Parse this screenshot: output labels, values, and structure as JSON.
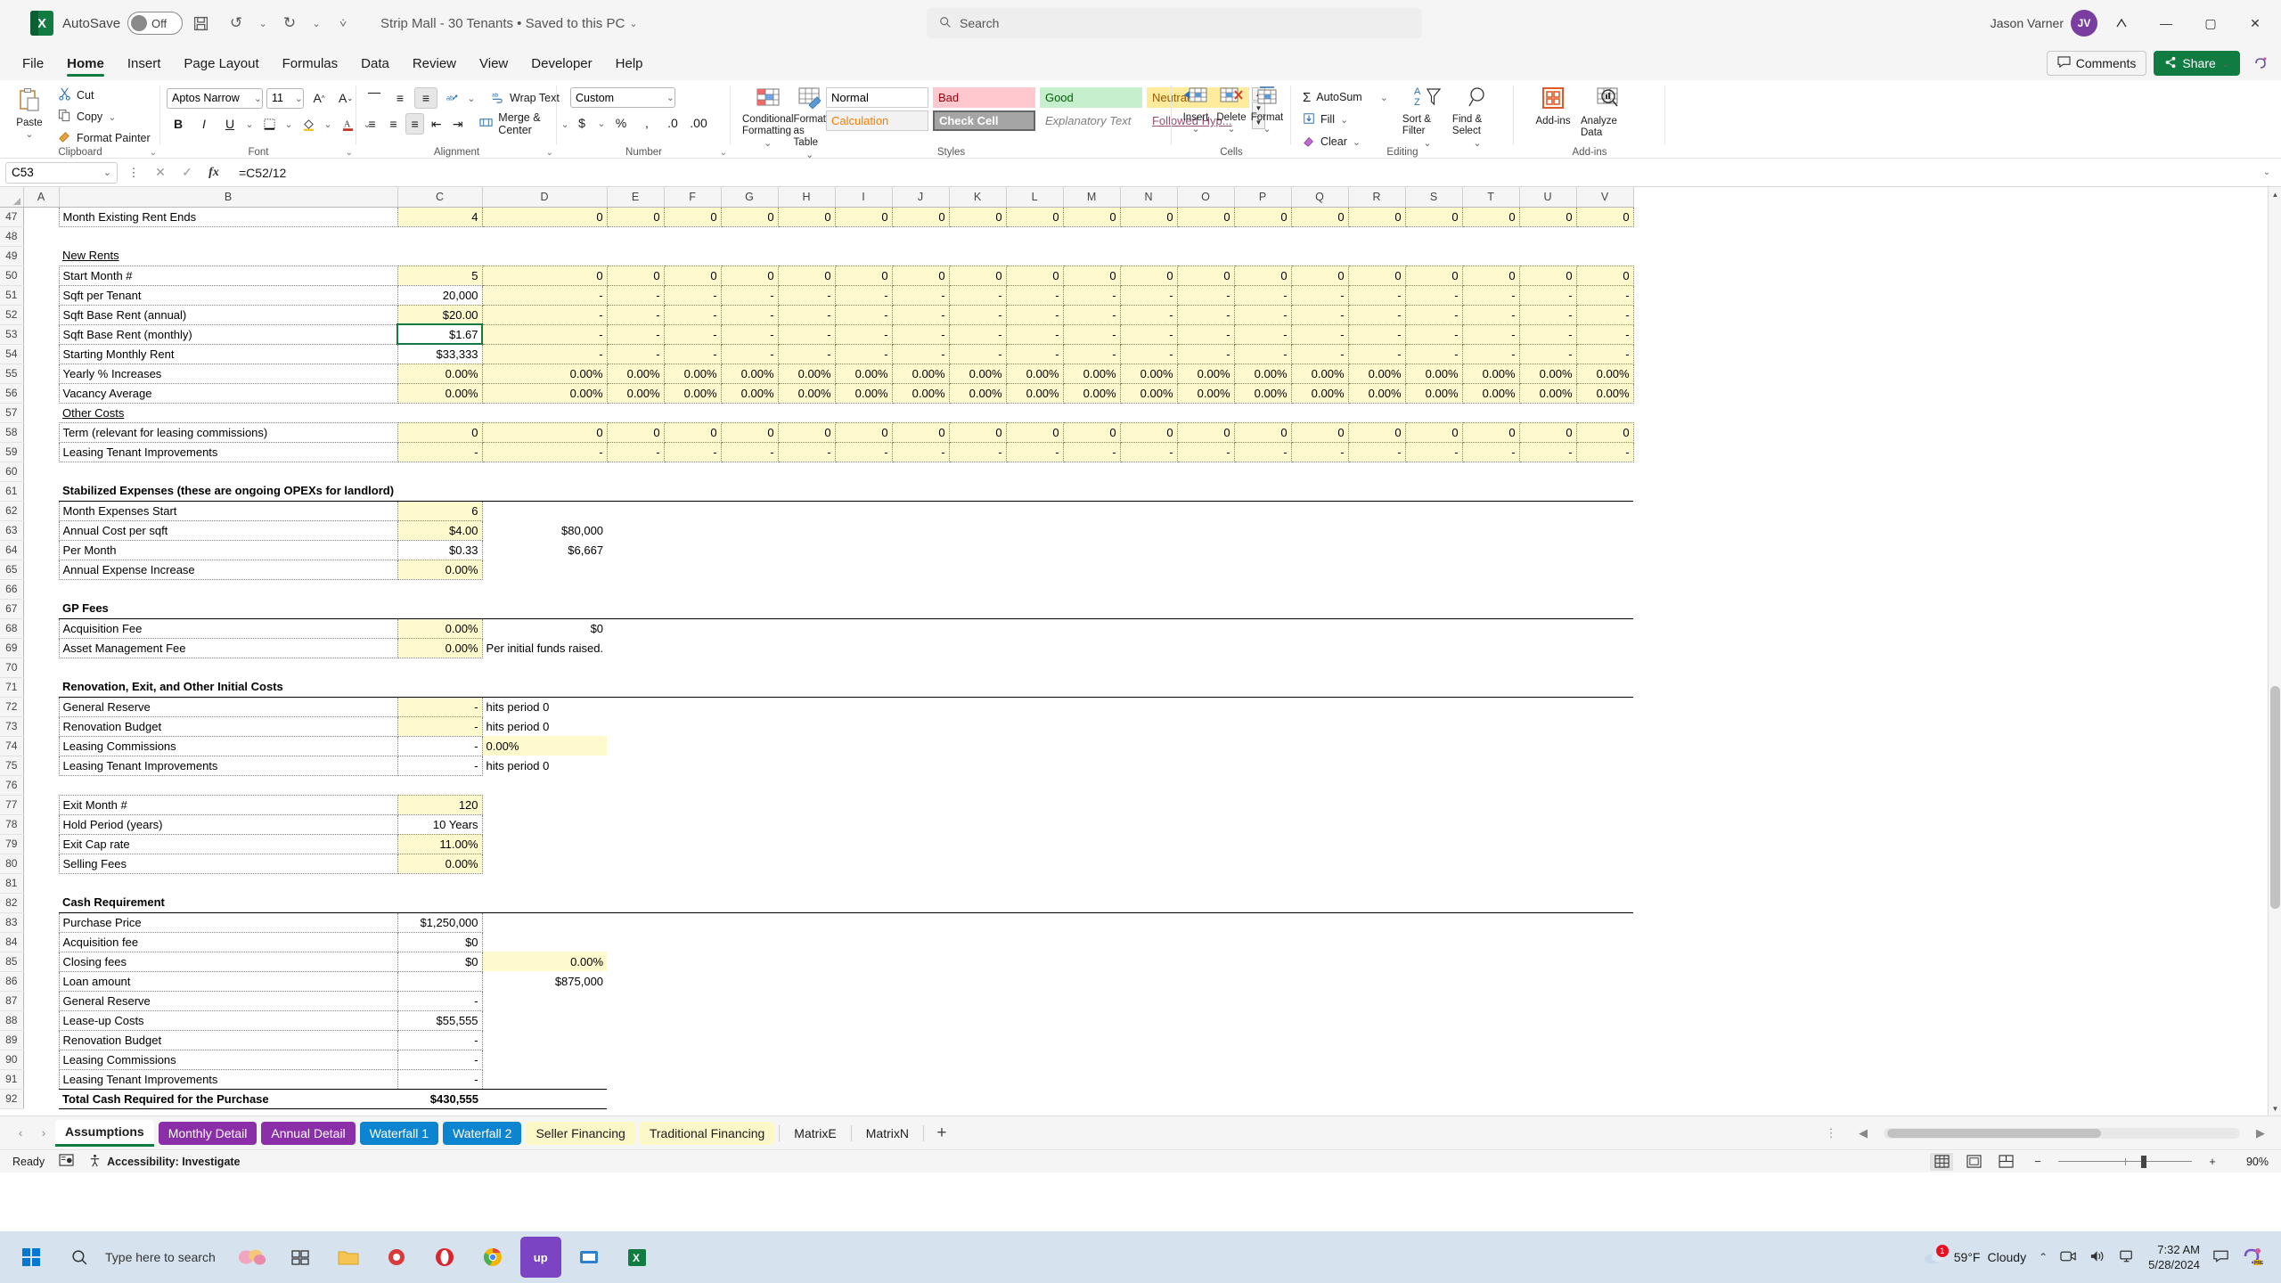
{
  "titlebar": {
    "autosave_label": "AutoSave",
    "autosave_state": "Off",
    "doc_title": "Strip Mall - 30 Tenants • Saved to this PC",
    "search_placeholder": "Search",
    "user_name": "Jason Varner",
    "user_initials": "JV",
    "icons": [
      "save-icon",
      "undo-icon",
      "redo-icon",
      "customize-quick-access-icon"
    ]
  },
  "menu": {
    "items": [
      "File",
      "Home",
      "Insert",
      "Page Layout",
      "Formulas",
      "Data",
      "Review",
      "View",
      "Developer",
      "Help"
    ],
    "active": "Home",
    "comments_label": "Comments",
    "share_label": "Share"
  },
  "ribbon": {
    "clipboard": {
      "label": "Clipboard",
      "paste": "Paste",
      "cut": "Cut",
      "copy": "Copy",
      "format_painter": "Format Painter"
    },
    "font": {
      "label": "Font",
      "family": "Aptos Narrow",
      "size": "11",
      "bold": "B",
      "italic": "I",
      "underline": "U"
    },
    "alignment": {
      "label": "Alignment",
      "wrap_text": "Wrap Text",
      "merge_center": "Merge & Center"
    },
    "number": {
      "label": "Number",
      "format": "Custom"
    },
    "styles": {
      "label": "Styles",
      "conditional_formatting": "Conditional Formatting",
      "format_as_table": "Format as Table",
      "gallery": [
        {
          "name": "Normal",
          "bg": "#ffffff",
          "fg": "#000000"
        },
        {
          "name": "Bad",
          "bg": "#ffc7ce",
          "fg": "#9c0006"
        },
        {
          "name": "Good",
          "bg": "#c6efce",
          "fg": "#006100"
        },
        {
          "name": "Neutral",
          "bg": "#ffeb9c",
          "fg": "#9c5700"
        },
        {
          "name": "Calculation",
          "bg": "#f2f2f2",
          "fg": "#fa7d00"
        },
        {
          "name": "Check Cell",
          "bg": "#a5a5a5",
          "fg": "#ffffff"
        },
        {
          "name": "Explanatory Text",
          "bg": "#ffffff",
          "fg": "#7f7f7f"
        },
        {
          "name": "Followed Hyp...",
          "bg": "#ffffff",
          "fg": "#954f72"
        }
      ]
    },
    "cells": {
      "label": "Cells",
      "insert": "Insert",
      "delete": "Delete",
      "format": "Format"
    },
    "editing": {
      "label": "Editing",
      "autosum": "AutoSum",
      "fill": "Fill",
      "clear": "Clear",
      "sort_filter": "Sort & Filter",
      "find_select": "Find & Select"
    },
    "addins": {
      "label": "Add-ins",
      "addins": "Add-ins",
      "analyze_data": "Analyze Data"
    }
  },
  "formula_bar": {
    "name_box": "C53",
    "formula": "=C52/12",
    "cancel_icon": "close-icon",
    "confirm_icon": "check-icon",
    "function_icon": "fx-icon"
  },
  "grid": {
    "columns": [
      "A",
      "B",
      "C",
      "D",
      "E",
      "F",
      "G",
      "H",
      "I",
      "J",
      "K",
      "L",
      "M",
      "N",
      "O",
      "P",
      "Q",
      "R",
      "S",
      "T",
      "U",
      "V"
    ],
    "active_cell": "C53",
    "rows": [
      {
        "n": 47,
        "label": "Month Existing Rent Ends",
        "indent": 1,
        "c": "4",
        "style": "yellow-blue",
        "series": [
          "0",
          "0",
          "0",
          "0",
          "0",
          "0",
          "0",
          "0",
          "0",
          "0",
          "0",
          "0",
          "0",
          "0",
          "0",
          "0",
          "0",
          "0",
          "0"
        ],
        "box": "mid"
      },
      {
        "n": 48,
        "label": "",
        "indent": 0,
        "c": "",
        "style": "blank",
        "series": []
      },
      {
        "n": 49,
        "label": "New Rents",
        "indent": 0,
        "c": "",
        "style": "section-underline",
        "series": []
      },
      {
        "n": 50,
        "label": "Start Month #",
        "indent": 1,
        "c": "5",
        "style": "yellow-blue",
        "series": [
          "0",
          "0",
          "0",
          "0",
          "0",
          "0",
          "0",
          "0",
          "0",
          "0",
          "0",
          "0",
          "0",
          "0",
          "0",
          "0",
          "0",
          "0",
          "0"
        ],
        "box": "top"
      },
      {
        "n": 51,
        "label": "Sqft per Tenant",
        "indent": 1,
        "c": "20,000",
        "style": "plain",
        "series": [
          "-",
          "-",
          "-",
          "-",
          "-",
          "-",
          "-",
          "-",
          "-",
          "-",
          "-",
          "-",
          "-",
          "-",
          "-",
          "-",
          "-",
          "-",
          "-"
        ],
        "box": "mid"
      },
      {
        "n": 52,
        "label": "Sqft Base Rent (annual)",
        "indent": 1,
        "c": "$20.00",
        "style": "yellow-blue",
        "series": [
          "-",
          "-",
          "-",
          "-",
          "-",
          "-",
          "-",
          "-",
          "-",
          "-",
          "-",
          "-",
          "-",
          "-",
          "-",
          "-",
          "-",
          "-",
          "-"
        ],
        "box": "mid"
      },
      {
        "n": 53,
        "label": "Sqft Base Rent (monthly)",
        "indent": 1,
        "c": "$1.67",
        "style": "plain",
        "series": [
          "-",
          "-",
          "-",
          "-",
          "-",
          "-",
          "-",
          "-",
          "-",
          "-",
          "-",
          "-",
          "-",
          "-",
          "-",
          "-",
          "-",
          "-",
          "-"
        ],
        "box": "mid"
      },
      {
        "n": 54,
        "label": "Starting Monthly Rent",
        "indent": 1,
        "c": "$33,333",
        "style": "plain",
        "series": [
          "-",
          "-",
          "-",
          "-",
          "-",
          "-",
          "-",
          "-",
          "-",
          "-",
          "-",
          "-",
          "-",
          "-",
          "-",
          "-",
          "-",
          "-",
          "-"
        ],
        "box": "mid"
      },
      {
        "n": 55,
        "label": "Yearly % Increases",
        "indent": 1,
        "c": "0.00%",
        "style": "yellow-blue",
        "series": [
          "0.00%",
          "0.00%",
          "0.00%",
          "0.00%",
          "0.00%",
          "0.00%",
          "0.00%",
          "0.00%",
          "0.00%",
          "0.00%",
          "0.00%",
          "0.00%",
          "0.00%",
          "0.00%",
          "0.00%",
          "0.00%",
          "0.00%",
          "0.00%",
          "0.00%"
        ],
        "box": "mid"
      },
      {
        "n": 56,
        "label": "Vacancy Average",
        "indent": 1,
        "c": "0.00%",
        "style": "yellow-blue",
        "series": [
          "0.00%",
          "0.00%",
          "0.00%",
          "0.00%",
          "0.00%",
          "0.00%",
          "0.00%",
          "0.00%",
          "0.00%",
          "0.00%",
          "0.00%",
          "0.00%",
          "0.00%",
          "0.00%",
          "0.00%",
          "0.00%",
          "0.00%",
          "0.00%",
          "0.00%"
        ],
        "box": "bot"
      },
      {
        "n": 57,
        "label": "Other Costs",
        "indent": 0,
        "c": "",
        "style": "section-underline",
        "series": []
      },
      {
        "n": 58,
        "label": "Term (relevant for leasing commissions)",
        "indent": 1,
        "c": "0",
        "style": "yellow-blue",
        "series": [
          "0",
          "0",
          "0",
          "0",
          "0",
          "0",
          "0",
          "0",
          "0",
          "0",
          "0",
          "0",
          "0",
          "0",
          "0",
          "0",
          "0",
          "0",
          "0"
        ],
        "box": "top"
      },
      {
        "n": 59,
        "label": "Leasing Tenant Improvements",
        "indent": 1,
        "c": "-",
        "style": "yellow-blue",
        "series": [
          "-",
          "-",
          "-",
          "-",
          "-",
          "-",
          "-",
          "-",
          "-",
          "-",
          "-",
          "-",
          "-",
          "-",
          "-",
          "-",
          "-",
          "-",
          "-"
        ],
        "box": "bot"
      },
      {
        "n": 60,
        "label": "",
        "indent": 0,
        "c": "",
        "style": "blank",
        "series": []
      },
      {
        "n": 61,
        "label": "Stabilized Expenses (these are ongoing OPEXs for landlord)",
        "indent": 0,
        "c": "",
        "style": "header-bold",
        "series": []
      },
      {
        "n": 62,
        "label": "Month Expenses Start",
        "indent": 1,
        "c": "6",
        "style": "yellow-blue",
        "series": [],
        "d": ""
      },
      {
        "n": 63,
        "label": "Annual Cost per sqft",
        "indent": 1,
        "c": "$4.00",
        "style": "yellow-blue",
        "series": [],
        "d": "$80,000"
      },
      {
        "n": 64,
        "label": "Per Month",
        "indent": 2,
        "c": "$0.33",
        "style": "plain",
        "series": [],
        "d": "$6,667"
      },
      {
        "n": 65,
        "label": "Annual Expense Increase",
        "indent": 1,
        "c": "0.00%",
        "style": "yellow-blue-end",
        "series": [],
        "d": ""
      },
      {
        "n": 66,
        "label": "",
        "indent": 0,
        "c": "",
        "style": "blank",
        "series": []
      },
      {
        "n": 67,
        "label": "GP Fees",
        "indent": 0,
        "c": "",
        "style": "header-bold",
        "series": []
      },
      {
        "n": 68,
        "label": "Acquisition Fee",
        "indent": 1,
        "c": "0.00%",
        "style": "yellow-blue",
        "series": [],
        "d": "$0"
      },
      {
        "n": 69,
        "label": "Asset Management Fee",
        "indent": 1,
        "c": "0.00%",
        "style": "yellow-blue",
        "series": [],
        "d": "Per initial funds raised.",
        "d_align": "left"
      },
      {
        "n": 70,
        "label": "",
        "indent": 0,
        "c": "",
        "style": "blank",
        "series": []
      },
      {
        "n": 71,
        "label": "Renovation, Exit, and Other Initial Costs",
        "indent": 0,
        "c": "",
        "style": "header-bold",
        "series": []
      },
      {
        "n": 72,
        "label": "General Reserve",
        "indent": 1,
        "c": "-",
        "style": "yellow-blue",
        "series": [],
        "d": "hits period 0",
        "d_align": "left",
        "box": "top"
      },
      {
        "n": 73,
        "label": "Renovation Budget",
        "indent": 1,
        "c": "-",
        "style": "yellow-blue",
        "series": [],
        "d": "hits period 0",
        "d_align": "left",
        "box": "mid"
      },
      {
        "n": 74,
        "label": "Leasing Commissions",
        "indent": 1,
        "c": "-",
        "style": "plain",
        "series": [],
        "d": "0.00%",
        "d_align": "left",
        "d_style": "yellow-blue",
        "box": "mid"
      },
      {
        "n": 75,
        "label": "Leasing Tenant Improvements",
        "indent": 1,
        "c": "-",
        "style": "plain",
        "series": [],
        "d": "hits period 0",
        "d_align": "left",
        "box": "bot"
      },
      {
        "n": 76,
        "label": "",
        "indent": 0,
        "c": "",
        "style": "blank",
        "series": []
      },
      {
        "n": 77,
        "label": "Exit Month #",
        "indent": 1,
        "c": "120",
        "style": "yellow-blue",
        "series": [],
        "box": "top"
      },
      {
        "n": 78,
        "label": "Hold Period (years)",
        "indent": 1,
        "c": "10 Years",
        "style": "plain",
        "series": [],
        "box": "mid"
      },
      {
        "n": 79,
        "label": "Exit Cap rate",
        "indent": 1,
        "c": "11.00%",
        "style": "yellow-blue",
        "series": [],
        "box": "mid"
      },
      {
        "n": 80,
        "label": "Selling Fees",
        "indent": 1,
        "c": "0.00%",
        "style": "yellow-blue",
        "series": [],
        "box": "bot"
      },
      {
        "n": 81,
        "label": "",
        "indent": 0,
        "c": "",
        "style": "blank",
        "series": []
      },
      {
        "n": 82,
        "label": "Cash Requirement",
        "indent": 0,
        "c": "",
        "style": "header-bold",
        "series": []
      },
      {
        "n": 83,
        "label": "Purchase Price",
        "indent": 1,
        "c": "$1,250,000",
        "style": "plain",
        "series": []
      },
      {
        "n": 84,
        "label": "Acquisition fee",
        "indent": 1,
        "c": "$0",
        "style": "plain",
        "series": []
      },
      {
        "n": 85,
        "label": "Closing fees",
        "indent": 1,
        "c": "$0",
        "style": "plain",
        "series": [],
        "d": "0.00%",
        "d_style": "yellow-blue"
      },
      {
        "n": 86,
        "label": "Loan amount",
        "indent": 1,
        "c": "",
        "style": "plain",
        "series": [],
        "d": "$875,000"
      },
      {
        "n": 87,
        "label": "General Reserve",
        "indent": 1,
        "c": "-",
        "style": "plain",
        "series": []
      },
      {
        "n": 88,
        "label": "Lease-up Costs",
        "indent": 1,
        "c": "$55,555",
        "style": "plain",
        "series": []
      },
      {
        "n": 89,
        "label": "Renovation Budget",
        "indent": 1,
        "c": "-",
        "style": "plain",
        "series": []
      },
      {
        "n": 90,
        "label": "Leasing Commissions",
        "indent": 1,
        "c": "-",
        "style": "plain",
        "series": []
      },
      {
        "n": 91,
        "label": "Leasing Tenant Improvements",
        "indent": 1,
        "c": "-",
        "style": "plain",
        "series": []
      },
      {
        "n": 92,
        "label": "Total Cash Required for the Purchase",
        "indent": 1,
        "c": "$430,555",
        "style": "total",
        "series": []
      }
    ]
  },
  "sheet_tabs": {
    "items": [
      {
        "label": "Assumptions",
        "kind": "active"
      },
      {
        "label": "Monthly Detail",
        "kind": "purple"
      },
      {
        "label": "Annual Detail",
        "kind": "purple"
      },
      {
        "label": "Waterfall 1",
        "kind": "blue"
      },
      {
        "label": "Waterfall 2",
        "kind": "blue"
      },
      {
        "label": "Seller Financing",
        "kind": "yellow"
      },
      {
        "label": "Traditional Financing",
        "kind": "yellow"
      },
      {
        "label": "MatrixE",
        "kind": "plain"
      },
      {
        "label": "MatrixN",
        "kind": "plain"
      }
    ],
    "add_label": "+"
  },
  "status_bar": {
    "ready": "Ready",
    "accessibility": "Accessibility: Investigate",
    "zoom": "90%",
    "views": [
      "normal-view-icon",
      "page-layout-icon",
      "page-break-icon"
    ]
  },
  "taskbar": {
    "search_placeholder": "Type here to search",
    "weather_temp": "59°F",
    "weather_desc": "Cloudy",
    "time": "7:32 AM",
    "date": "5/28/2024",
    "badge_count": "1"
  }
}
